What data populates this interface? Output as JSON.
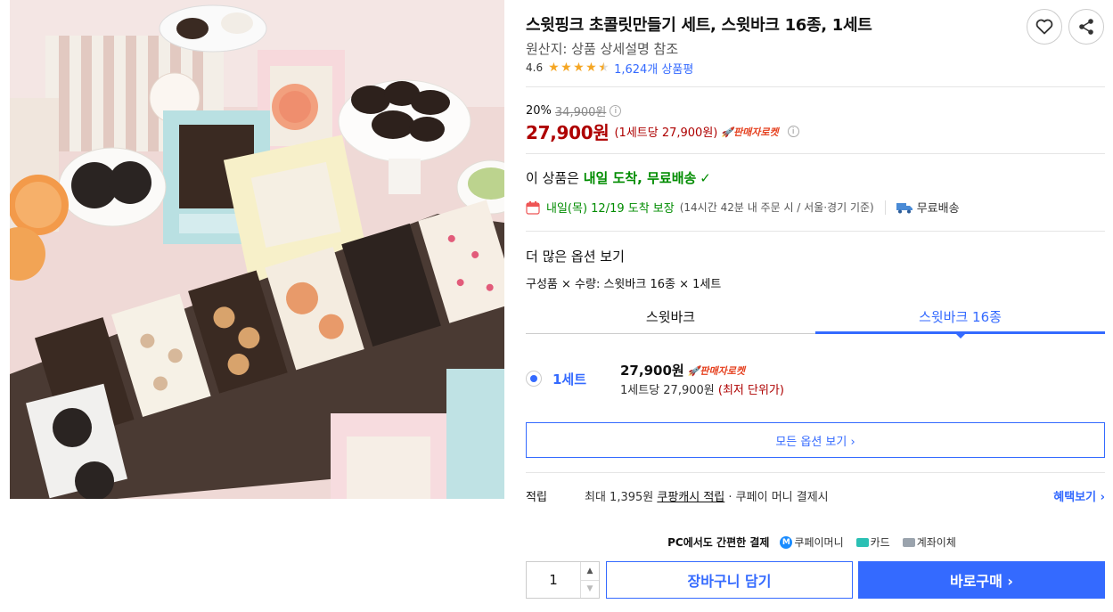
{
  "product": {
    "title": "스윗핑크 초콜릿만들기 세트, 스윗바크 16종, 1세트",
    "origin": "원산지: 상품 상세설명 참조",
    "rating_value": "4.6",
    "rating_stars": 4.5,
    "review_count": "1,624개 상품평"
  },
  "price": {
    "discount_rate": "20%",
    "original_price": "34,900원",
    "sale_price": "27,900원",
    "unit_price": "(1세트당 27,900원)",
    "rocket_badge": "판매자로켓"
  },
  "delivery": {
    "head_prefix": "이 상품은",
    "head_highlight": "내일 도착, 무료배송",
    "arrival": "내일(목) 12/19 도착 보장",
    "arrival_note": "(14시간 42분  내 주문 시 / 서울·경기 기준)",
    "free_shipping": "무료배송"
  },
  "options": {
    "section_title": "더 많은 옵션 보기",
    "composition": "구성품 × 수량: 스윗바크 16종 × 1세트",
    "tabs": [
      {
        "label": "스윗바크",
        "active": false
      },
      {
        "label": "스윗바크 16종",
        "active": true
      }
    ],
    "selected": {
      "name": "1세트",
      "price": "27,900원",
      "badge": "판매자로켓",
      "unit": "1세트당 27,900원",
      "lowest": "(최저 단위가)"
    },
    "all_options_label": "모든 옵션 보기 ›"
  },
  "reward": {
    "label": "적립",
    "text_before": "최대 1,395원 ",
    "text_link": "쿠팡캐시 적립",
    "text_after": " · 쿠페이 머니 결제시",
    "benefit_link": "혜택보기 ›"
  },
  "payment": {
    "title": "PC에서도 간편한 결제",
    "methods": [
      "쿠페이머니",
      "카드",
      "계좌이체"
    ]
  },
  "purchase": {
    "quantity": "1",
    "cart_label": "장바구니 담기",
    "buy_label": "바로구매 ›"
  },
  "colors": {
    "accent": "#346aff",
    "price_red": "#ae0000",
    "delivery_green": "#008c00",
    "star": "#f5a623"
  }
}
